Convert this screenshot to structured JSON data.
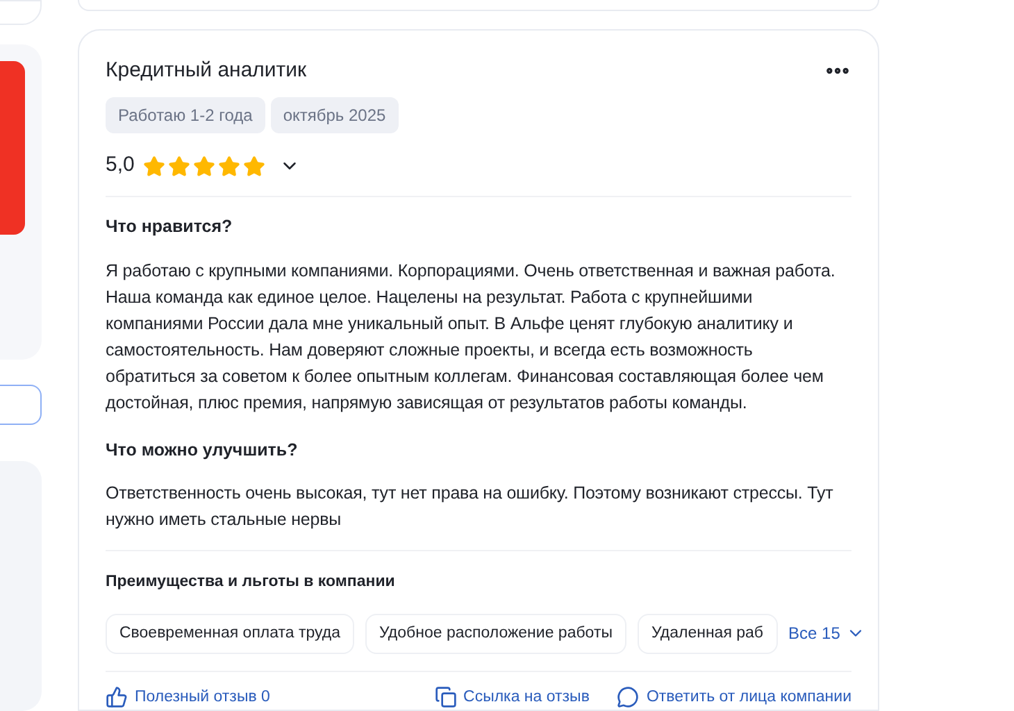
{
  "review": {
    "title": "Кредитный аналитик",
    "tags": [
      "Работаю 1-2 года",
      "октябрь 2025"
    ],
    "rating": {
      "value": "5,0",
      "stars": 5
    },
    "sections": [
      {
        "heading": "Что нравится?",
        "text": "Я работаю с крупными компаниями. Корпорациями. Очень ответственная и важная работа. Наша команда как единое целое. Нацелены на результат. Работа с крупнейшими компаниями России дала мне уникальный опыт. В Альфе ценят глубокую аналитику и самостоятельность. Нам доверяют сложные проекты, и всегда есть возможность обратиться за советом к более опытным коллегам. Финансовая составляющая более чем достойная, плюс премия, напрямую зависящая от результатов работы команды."
      },
      {
        "heading": "Что можно улучшить?",
        "text": "Ответственность очень высокая, тут нет права на ошибку. Поэтому возникают стрессы. Тут нужно иметь стальные нервы"
      }
    ],
    "benefits": {
      "heading": "Преимущества и льготы в компании",
      "items": [
        "Своевременная оплата труда",
        "Удобное расположение работы",
        "Удаленная раб"
      ],
      "more": "Все 15"
    },
    "actions": [
      {
        "kind": "like",
        "label": "Полезный отзыв 0"
      },
      {
        "kind": "link",
        "label": "Ссылка на отзыв"
      },
      {
        "kind": "reply",
        "label": "Ответить от лица компании"
      }
    ]
  }
}
